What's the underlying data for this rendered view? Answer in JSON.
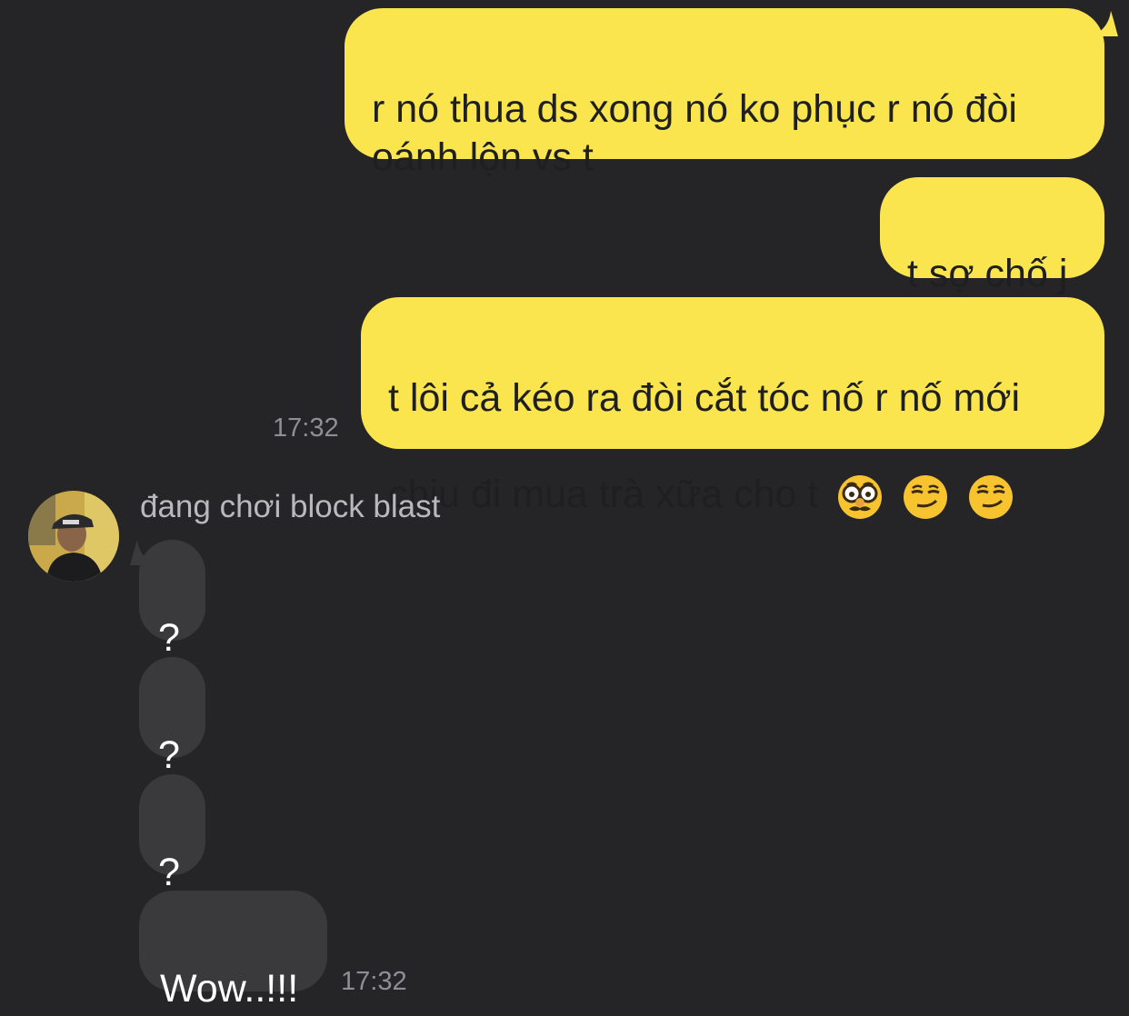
{
  "conversation": {
    "outgoing": [
      {
        "text": "r nó thua ds xong nó ko phục r nó đòi\noánh lộn vs t"
      },
      {
        "text": "t sợ chố j"
      },
      {
        "line1": "t lôi cả kéo ra đòi cắt tóc nố r nố mới",
        "line2": "chịu đi mua trà xữa cho t",
        "emojis": [
          "disguised-face-emoji",
          "smirking-face-emoji",
          "smirking-face-emoji"
        ]
      }
    ],
    "outgoing_time": "17:32",
    "sender_name": "đang chơi block blast",
    "incoming": [
      {
        "text": "?"
      },
      {
        "text": "?"
      },
      {
        "text": "?"
      },
      {
        "text": "Wow..!!!"
      }
    ],
    "incoming_time": "17:32"
  },
  "colors": {
    "background": "#252528",
    "outgoing_bubble": "#fae54e",
    "incoming_bubble": "#3a3a3c",
    "timestamp": "#8e8e93"
  }
}
